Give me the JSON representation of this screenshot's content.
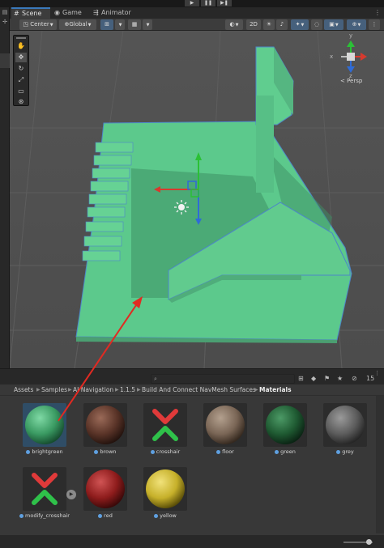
{
  "playbar": {
    "play_icon": "play-icon",
    "pause_icon": "pause-icon",
    "step_icon": "step-icon"
  },
  "tabs": [
    {
      "label": "Scene",
      "icon": "grid-icon"
    },
    {
      "label": "Game",
      "icon": "gamepad-icon"
    },
    {
      "label": "Animator",
      "icon": "animator-icon"
    }
  ],
  "scene_toolbar": {
    "pivot_mode": "Center",
    "pivot_space": "Global",
    "mode_2d": "2D"
  },
  "scene": {
    "persp_label": "< Persp",
    "gizmo_axes": {
      "y": "y",
      "x": "x",
      "z": "z"
    },
    "colors": {
      "floor_top": "#5cc98c",
      "floor_front": "#57b984",
      "shadow": "#3b8660",
      "outline": "#4c86c8",
      "background": "#4a4a4a",
      "handle_y": "#2bc036",
      "handle_x": "#d63a2e",
      "handle_z": "#2f6bd6",
      "arrow": "#e12a22"
    }
  },
  "project": {
    "search_placeholder": "",
    "hidden_count": "15",
    "breadcrumbs": [
      "Assets",
      "Samples",
      "AI Navigation",
      "1.1.5",
      "Build And Connect NavMesh Surfaces",
      "Materials"
    ],
    "assets": [
      {
        "name": "brightgreen",
        "color": "#3a9a62",
        "kind": "sphere",
        "selected": true
      },
      {
        "name": "brown",
        "color": "#5a3428",
        "kind": "sphere",
        "selected": false
      },
      {
        "name": "crosshair",
        "color": "",
        "kind": "crosshair",
        "selected": false
      },
      {
        "name": "floor",
        "color": "#7a6656",
        "kind": "sphere",
        "selected": false
      },
      {
        "name": "green",
        "color": "#1f5a32",
        "kind": "sphere",
        "selected": false
      },
      {
        "name": "grey",
        "color": "#5c5c5c",
        "kind": "sphere",
        "selected": false
      },
      {
        "name": "modify_crosshair",
        "color": "",
        "kind": "crosshair",
        "selected": false
      },
      {
        "name": "red",
        "color": "#8e1c1c",
        "kind": "sphere",
        "selected": false
      },
      {
        "name": "yellow",
        "color": "#c6b02a",
        "kind": "sphere",
        "selected": false
      }
    ]
  }
}
